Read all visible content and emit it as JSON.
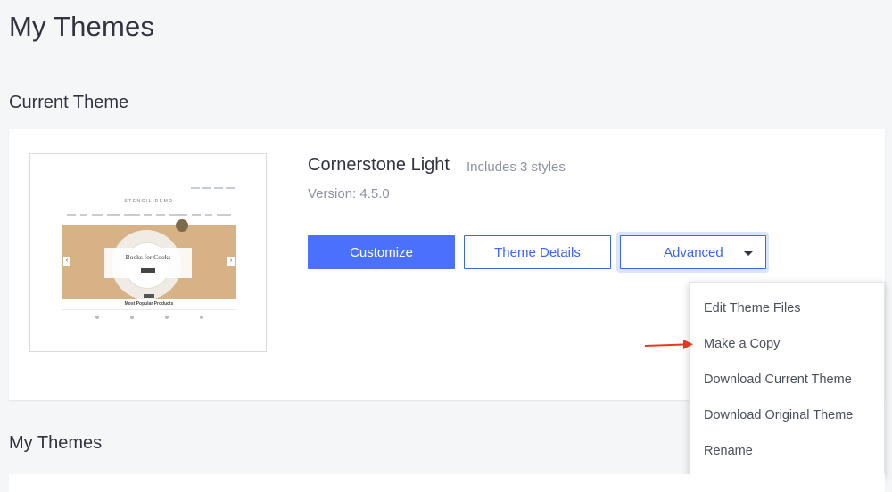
{
  "page": {
    "title": "My Themes"
  },
  "current_section": {
    "title": "Current Theme"
  },
  "theme": {
    "name": "Cornerstone Light",
    "styles": "Includes 3 styles",
    "version": "Version: 4.5.0",
    "preview": {
      "brand": "STENCIL DEMO",
      "hero_text": "Books for Cooks",
      "arrow_left": "‹",
      "arrow_right": "›",
      "popular": "Most Popular Products"
    }
  },
  "actions": {
    "customize": "Customize",
    "details": "Theme Details",
    "advanced": "Advanced"
  },
  "advanced_menu": {
    "items": [
      "Edit Theme Files",
      "Make a Copy",
      "Download Current Theme",
      "Download Original Theme",
      "Rename"
    ]
  },
  "my_themes_section": {
    "title": "My Themes"
  },
  "colors": {
    "primary": "#4b71fc",
    "link": "#3c64f4",
    "annotation_arrow": "#e8381f"
  }
}
